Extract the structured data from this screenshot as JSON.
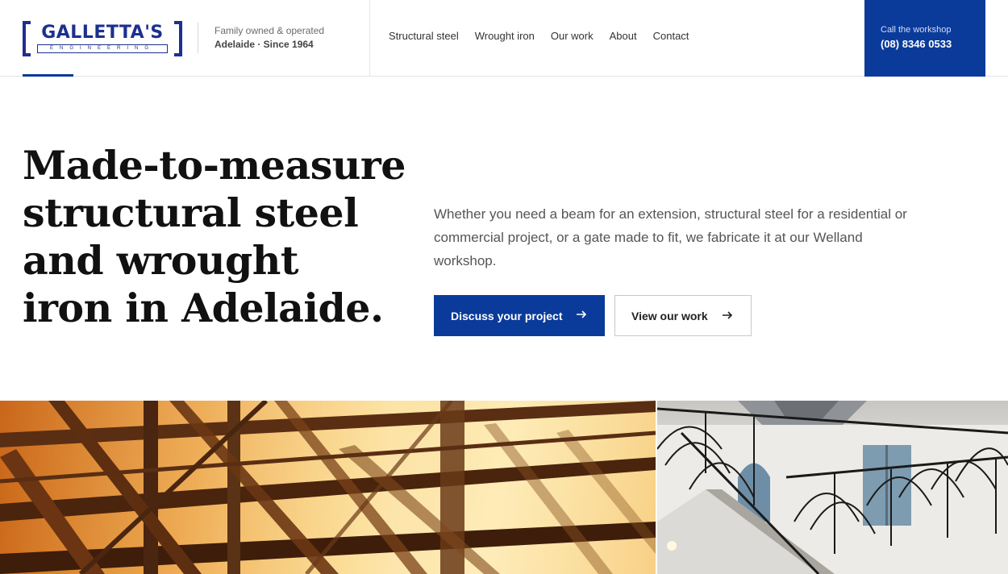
{
  "brand": {
    "name": "GALLETTA'S",
    "sub": "ENGINEERING",
    "tagline_1": "Family owned & operated",
    "tagline_2": "Adelaide · Since 1964",
    "color": "#1d2f8f"
  },
  "nav": {
    "items": [
      {
        "label": "Structural steel"
      },
      {
        "label": "Wrought iron"
      },
      {
        "label": "Our work"
      },
      {
        "label": "About"
      },
      {
        "label": "Contact"
      }
    ]
  },
  "call": {
    "label": "Call the workshop",
    "number": "(08) 8346 0533"
  },
  "hero": {
    "title_lines": [
      "Made-to-measure",
      "structural steel",
      "and wrought",
      "iron in Adelaide."
    ],
    "text": "Whether you need a beam for an extension, structural steel for a residential or commercial project, or a gate made to fit, we fabricate it at our Welland workshop.",
    "primary_button": "Discuss your project",
    "secondary_button": "View our work"
  },
  "images": {
    "left": "structural-steel-frame-photo",
    "right": "wrought-iron-balustrade-photo"
  },
  "colors": {
    "accent": "#0a3a9a"
  }
}
